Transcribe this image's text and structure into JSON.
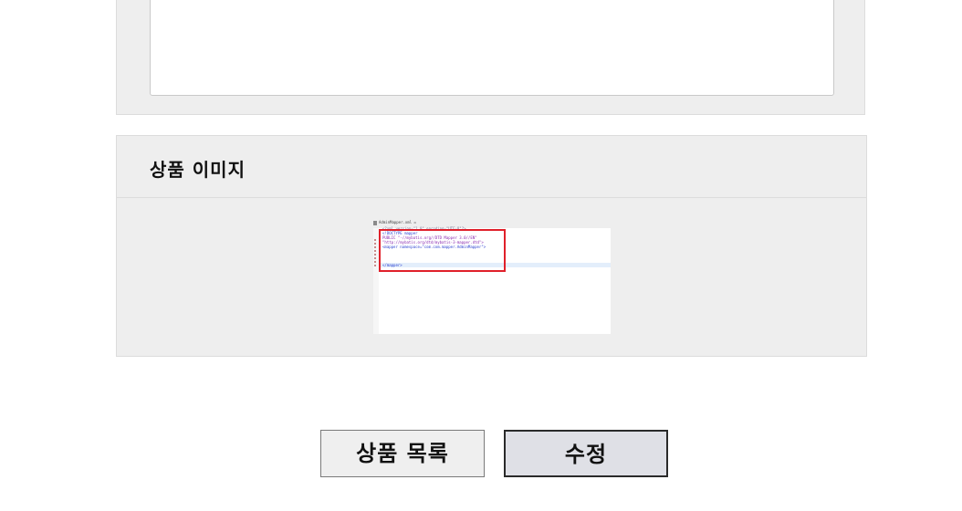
{
  "description_section": {
    "textarea_value": ""
  },
  "image_section": {
    "title": "상품 이미지",
    "preview": {
      "tab_label": "AdminMapper.xml ☒",
      "code_lines": [
        {
          "text": "<?xml version=\"1.0\" encoding=\"UTF-8\"?>",
          "color": "gray"
        },
        {
          "text": "<!DOCTYPE mapper",
          "color": "blue"
        },
        {
          "text": "  PUBLIC \"-//mybatis.org//DTD Mapper 3.0//EN\"",
          "color": "purple"
        },
        {
          "text": "  \"http://mybatis.org/dtd/mybatis-3-mapper.dtd\">",
          "color": "purple"
        },
        {
          "text": "<mapper namespace=\"com.com.mapper.AdminMapper\">",
          "color": "blue"
        },
        {
          "text": "",
          "color": "gray"
        },
        {
          "text": "",
          "color": "gray"
        },
        {
          "text": "",
          "color": "gray"
        },
        {
          "text": "  </mapper>",
          "color": "blue"
        }
      ]
    }
  },
  "actions": {
    "list_button": "상품 목록",
    "edit_button": "수정"
  }
}
